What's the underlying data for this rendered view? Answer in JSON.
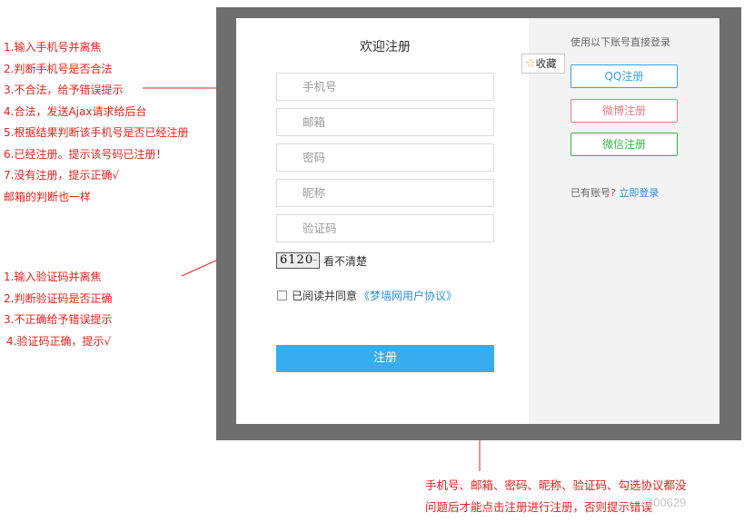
{
  "annotations": {
    "phone_steps": [
      "1.输入手机号并离焦",
      "2.判断手机号是否合法",
      "3.不合法，给予错误提示",
      "4.合法，发送Ajax请求给后台",
      "5.根据结果判断该手机号是否已经注册",
      "6.已经注册。提示该号码已注册！",
      "7.没有注册，提示正确√",
      "邮箱的判断也一样"
    ],
    "captcha_steps": [
      "1.输入验证码并离焦",
      "2.判断验证码是否正确",
      "3.不正确给予错误提示",
      "4.验证码正确，提示√"
    ],
    "submit_note": [
      "手机号、邮箱、密码、昵称、验证码、勾选协议都没",
      "问题后才能点击注册进行注册，否则提示错误"
    ],
    "watermark": "400629"
  },
  "form": {
    "title": "欢迎注册",
    "fields": {
      "phone_placeholder": "手机号",
      "email_placeholder": "邮箱",
      "password_placeholder": "密码",
      "nickname_placeholder": "昵称",
      "captcha_placeholder": "验证码"
    },
    "captcha": {
      "code": "6120",
      "refresh_label": "看不清楚"
    },
    "agreement": {
      "text": "已阅读并同意",
      "link": "《梦墙网用户协议》",
      "checked": false
    },
    "submit_label": "注册"
  },
  "favorite": {
    "icon": "star-icon",
    "label": "收藏"
  },
  "social": {
    "title": "使用以下账号直接登录",
    "qq_label": "QQ注册",
    "weibo_label": "微博注册",
    "wechat_label": "微信注册",
    "have_account": "已有账号?",
    "login_link": "立即登录"
  },
  "colors": {
    "annotation_red": "#e8201c",
    "submit_blue": "#37acef",
    "qq_blue": "#36a3e5",
    "weibo_pink": "#ee7a84",
    "wechat_green": "#3bb54a",
    "link_blue": "#2f8fd5",
    "frame_gray": "#6e6e6e"
  }
}
